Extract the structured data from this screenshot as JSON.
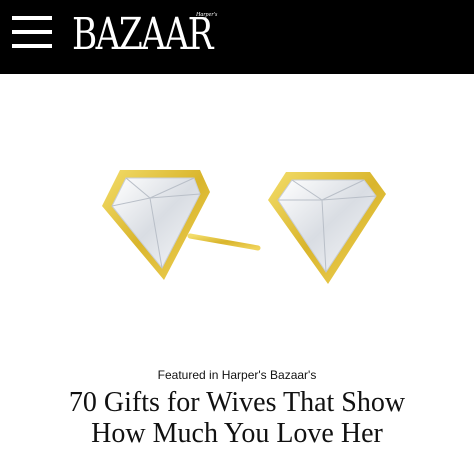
{
  "header": {
    "logo_text": "BAZAAR",
    "logo_small_text": "Harper's",
    "menu_icon": "hamburger-menu-icon"
  },
  "product": {
    "image_subject": "diamond-stud-earrings-icon",
    "colors": {
      "gold": "#e0c03a",
      "diamond": "#eef2f6"
    }
  },
  "article": {
    "featured_label": "Featured in Harper's Bazaar's",
    "title_line1": "70 Gifts for Wives That Show",
    "title_line2": "How Much You Love Her"
  }
}
